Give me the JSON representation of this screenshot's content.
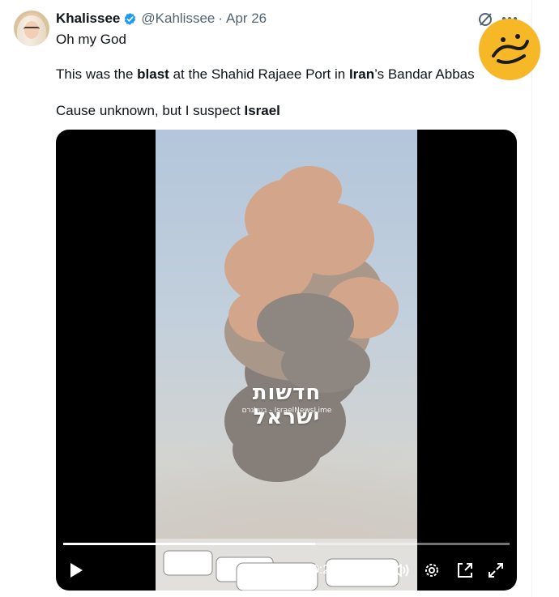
{
  "post": {
    "author_name": "Khalissee",
    "handle": "@Kahlissee",
    "separator": "·",
    "date": "Apr 26",
    "lines": {
      "l1": "Oh my God",
      "l2_a": "This was the ",
      "l2_b": "blast",
      "l2_c": " at the Shahid Rajaee Port in ",
      "l2_d": "Iran",
      "l2_e": "’s Bandar Abbas",
      "l3_a": "Cause unknown, but I suspect ",
      "l3_b": "Israel"
    }
  },
  "video": {
    "overlay_title": "חדשות ישראל",
    "overlay_subtitle": "בטלגרם - IsraelNewsLime",
    "time_display": "0:22 / 0:39",
    "progress": 0.5641
  },
  "icons": {
    "verified": "verified-badge-icon",
    "grok": "grok-icon",
    "more": "more-icon",
    "play": "play-icon",
    "volume": "volume-icon",
    "settings": "settings-gear-icon",
    "pip": "picture-in-picture-icon",
    "fullscreen": "fullscreen-icon"
  },
  "colors": {
    "verified": "#1d9bf0",
    "secondary_text": "#536471",
    "logo_bg": "#f7b827"
  }
}
